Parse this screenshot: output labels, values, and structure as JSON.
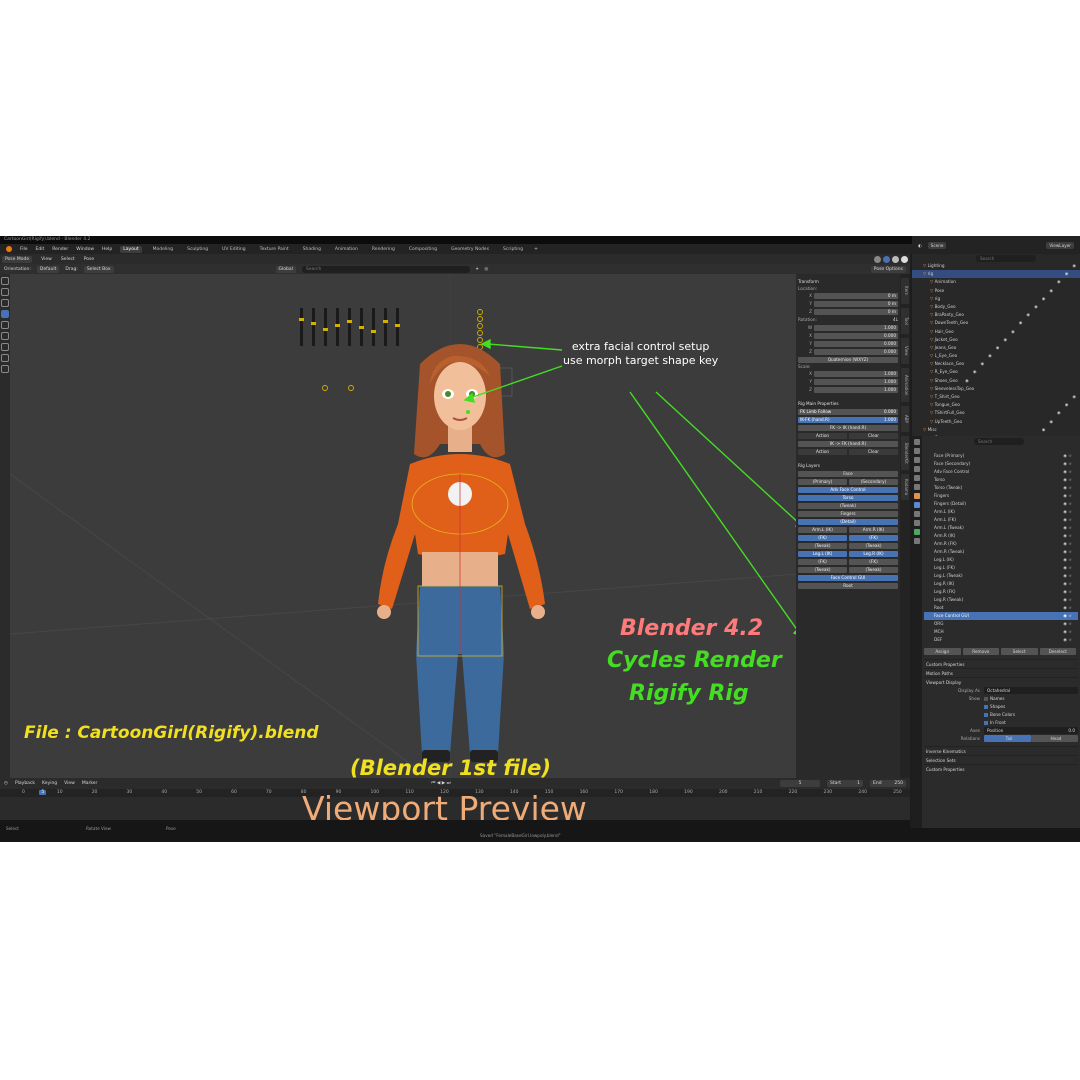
{
  "window": {
    "title": "CartoonGirl(Rigify).blend - Blender 4.2"
  },
  "menu": {
    "items": [
      "File",
      "Edit",
      "Render",
      "Window",
      "Help"
    ],
    "workspaces": [
      "Layout",
      "Modeling",
      "Sculpting",
      "UV Editing",
      "Texture Paint",
      "Shading",
      "Animation",
      "Rendering",
      "Compositing",
      "Geometry Nodes",
      "Scripting"
    ],
    "active_workspace": "Layout"
  },
  "header": {
    "mode": "Pose Mode",
    "menus": [
      "View",
      "Select",
      "Pose"
    ],
    "orientation_label": "Orientation:",
    "orientation_value": "Default",
    "drag_label": "Drag:",
    "drag_value": "Select Box",
    "transform_orientation": "Global",
    "search_placeholder": "Search",
    "pose_options": "Pose Options"
  },
  "outliner": {
    "scene": "Scene",
    "view_layer": "ViewLayer",
    "search_placeholder": "Search",
    "rows": [
      {
        "label": "Lighting",
        "indent": 1,
        "sel": false
      },
      {
        "label": "rig",
        "indent": 1,
        "sel": true
      },
      {
        "label": "Animation",
        "indent": 2,
        "sel": false
      },
      {
        "label": "Pose",
        "indent": 2,
        "sel": false
      },
      {
        "label": "rig",
        "indent": 2,
        "sel": false
      },
      {
        "label": "Body_Geo",
        "indent": 2,
        "sel": false
      },
      {
        "label": "BraPanty_Geo",
        "indent": 2,
        "sel": false
      },
      {
        "label": "DownTeeth_Geo",
        "indent": 2,
        "sel": false
      },
      {
        "label": "Hair_Geo",
        "indent": 2,
        "sel": false
      },
      {
        "label": "Jacket_Geo",
        "indent": 2,
        "sel": false
      },
      {
        "label": "Jeans_Geo",
        "indent": 2,
        "sel": false
      },
      {
        "label": "L_Eye_Geo",
        "indent": 2,
        "sel": false
      },
      {
        "label": "Necklace_Geo",
        "indent": 2,
        "sel": false
      },
      {
        "label": "R_Eye_Geo",
        "indent": 2,
        "sel": false
      },
      {
        "label": "Shoes_Geo",
        "indent": 2,
        "sel": false
      },
      {
        "label": "SleevelessTop_Geo",
        "indent": 2,
        "sel": false
      },
      {
        "label": "T_Shirt_Geo",
        "indent": 2,
        "sel": false
      },
      {
        "label": "Tongue_Geo",
        "indent": 2,
        "sel": false
      },
      {
        "label": "TShirtFull_Geo",
        "indent": 2,
        "sel": false
      },
      {
        "label": "UpTeeth_Geo",
        "indent": 2,
        "sel": false
      },
      {
        "label": "Misc",
        "indent": 1,
        "sel": false
      },
      {
        "label": "Camera",
        "indent": 2,
        "sel": false
      }
    ]
  },
  "npanel": {
    "transform_title": "Transform",
    "location_label": "Location:",
    "location": [
      {
        "axis": "X",
        "value": "0 m"
      },
      {
        "axis": "Y",
        "value": "0 m"
      },
      {
        "axis": "Z",
        "value": "0 m"
      }
    ],
    "rotation_label": "Rotation:",
    "rotation_mode_short": "4L",
    "rotation": [
      {
        "axis": "W",
        "value": "1.000"
      },
      {
        "axis": "X",
        "value": "0.000"
      },
      {
        "axis": "Y",
        "value": "0.000"
      },
      {
        "axis": "Z",
        "value": "0.000"
      }
    ],
    "rotation_mode": "Quaternion (WXYZ)",
    "scale_label": "Scale:",
    "scale": [
      {
        "axis": "X",
        "value": "1.000"
      },
      {
        "axis": "Y",
        "value": "1.000"
      },
      {
        "axis": "Z",
        "value": "1.000"
      }
    ],
    "rig_main_title": "Rig Main Properties",
    "fk_limb_follow": {
      "label": "FK Limb Follow",
      "value": "0.000"
    },
    "ik_fk": {
      "label": "IK-FK (hand.R)",
      "value": "1.000"
    },
    "fk_to_ik": "FK -> IK (hand.R)",
    "ik_to_fk": "IK -> FK (hand.R)",
    "action_label": "Action",
    "clear_label": "Clear",
    "rig_layers_title": "Rig Layers",
    "layers": [
      {
        "cols": [
          "Face"
        ],
        "on": [
          false
        ]
      },
      {
        "cols": [
          "(Primary)",
          "(Secondary)"
        ],
        "on": [
          false,
          false
        ]
      },
      {
        "cols": [
          "Adv Face Control"
        ],
        "on": [
          true
        ]
      },
      {
        "cols": [
          "Torso"
        ],
        "on": [
          true
        ]
      },
      {
        "cols": [
          "(Tweak)"
        ],
        "on": [
          false
        ]
      },
      {
        "cols": [
          "Fingers"
        ],
        "on": [
          false
        ]
      },
      {
        "cols": [
          "(Detail)"
        ],
        "on": [
          true
        ]
      },
      {
        "cols": [
          "Arm.L (IK)",
          "Arm.R (IK)"
        ],
        "on": [
          false,
          false
        ]
      },
      {
        "cols": [
          "(FK)",
          "(FK)"
        ],
        "on": [
          true,
          true
        ]
      },
      {
        "cols": [
          "(Tweak)",
          "(Tweak)"
        ],
        "on": [
          false,
          false
        ]
      },
      {
        "cols": [
          "Leg.L (IK)",
          "Leg.R (IK)"
        ],
        "on": [
          true,
          true
        ]
      },
      {
        "cols": [
          "(FK)",
          "(FK)"
        ],
        "on": [
          false,
          false
        ]
      },
      {
        "cols": [
          "(Tweak)",
          "(Tweak)"
        ],
        "on": [
          false,
          false
        ]
      },
      {
        "cols": [
          "Face Control GUI"
        ],
        "on": [
          true
        ]
      },
      {
        "cols": [
          "Root"
        ],
        "on": [
          false
        ]
      }
    ],
    "tabs": [
      "Item",
      "Tool",
      "View",
      "Animation",
      "ABP",
      "BlenderKit",
      "Kodama"
    ]
  },
  "properties": {
    "search_placeholder": "Search",
    "bone_collections": [
      {
        "label": "Face (Primary)",
        "sel": false
      },
      {
        "label": "Face (Secondary)",
        "sel": false
      },
      {
        "label": "Adv Face Control",
        "sel": false
      },
      {
        "label": "Torso",
        "sel": false
      },
      {
        "label": "Torso (Tweak)",
        "sel": false
      },
      {
        "label": "Fingers",
        "sel": false
      },
      {
        "label": "Fingers (Detail)",
        "sel": false
      },
      {
        "label": "Arm.L (IK)",
        "sel": false
      },
      {
        "label": "Arm.L (FK)",
        "sel": false
      },
      {
        "label": "Arm.L (Tweak)",
        "sel": false
      },
      {
        "label": "Arm.R (IK)",
        "sel": false
      },
      {
        "label": "Arm.R (FK)",
        "sel": false
      },
      {
        "label": "Arm.R (Tweak)",
        "sel": false
      },
      {
        "label": "Leg.L (IK)",
        "sel": false
      },
      {
        "label": "Leg.L (FK)",
        "sel": false
      },
      {
        "label": "Leg.L (Tweak)",
        "sel": false
      },
      {
        "label": "Leg.R (IK)",
        "sel": false
      },
      {
        "label": "Leg.R (FK)",
        "sel": false
      },
      {
        "label": "Leg.R (Tweak)",
        "sel": false
      },
      {
        "label": "Root",
        "sel": false
      },
      {
        "label": "Face Control GUI",
        "sel": true
      },
      {
        "label": "ORG",
        "sel": false
      },
      {
        "label": "MCH",
        "sel": false
      },
      {
        "label": "DEF",
        "sel": false
      }
    ],
    "assign": "Assign",
    "remove": "Remove",
    "select": "Select",
    "deselect": "Deselect",
    "custom_properties": "Custom Properties",
    "motion_paths": "Motion Paths",
    "viewport_display": "Viewport Display",
    "display_as_label": "Display As",
    "display_as_value": "Octahedral",
    "show_label": "Show",
    "show_names": "Names",
    "show_shapes": "Shapes",
    "show_bone_colors": "Bone Colors",
    "show_in_front": "In Front",
    "axes_label": "Axes",
    "axes_position": "Position",
    "axes_value": "0.0",
    "relations_label": "Relations",
    "relations_tail": "Tail",
    "relations_head": "Head",
    "inverse_kinematics": "Inverse Kinematics",
    "selection_sets": "Selection Sets",
    "custom_properties2": "Custom Properties"
  },
  "timeline": {
    "menus": [
      "Playback",
      "Keying",
      "View",
      "Marker"
    ],
    "current_frame": "5",
    "start_label": "Start",
    "start": "1",
    "end_label": "End",
    "end": "250",
    "ticks": [
      "0",
      "5",
      "10",
      "20",
      "30",
      "40",
      "50",
      "60",
      "70",
      "80",
      "90",
      "100",
      "110",
      "120",
      "130",
      "140",
      "150",
      "160",
      "170",
      "180",
      "190",
      "200",
      "210",
      "220",
      "230",
      "240",
      "250"
    ]
  },
  "status": {
    "select": "Select",
    "rotate_view": "Rotate View",
    "pose": "Pose",
    "saved": "Saved \"FemaleBaseGirl.lowpoly.blend\""
  },
  "annotations": {
    "facial_line1": "extra facial control setup",
    "facial_line2": "use morph target shape key",
    "file_label": "File : CartoonGirl(Rigify).blend",
    "blender_version": "Blender 4.2",
    "cycles": "Cycles Render",
    "rigify": "Rigify Rig",
    "first_file": "(Blender 1st file)",
    "viewport_preview": "Viewport Preview"
  },
  "colors": {
    "accent_blue": "#4772b3",
    "annotation_yellow": "#f0e020",
    "annotation_green": "#44dd22",
    "annotation_pink": "#ff7a7a",
    "annotation_peach": "#f0ac78",
    "sweater": "#e0601a",
    "jeans": "#3d6a9c",
    "hair": "#a4532a"
  }
}
